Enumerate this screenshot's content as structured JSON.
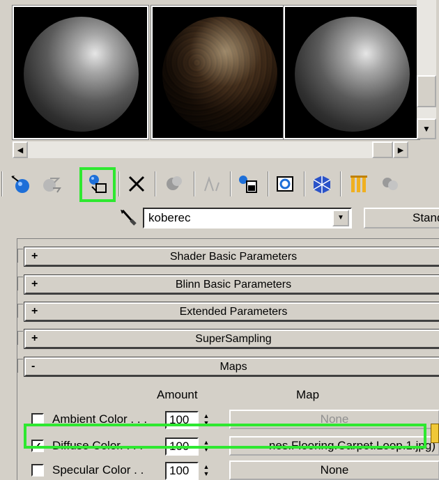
{
  "slots": [
    {
      "material": "gray-sphere"
    },
    {
      "material": "carpet-sphere",
      "selected": true
    },
    {
      "material": "gray-sphere"
    }
  ],
  "toolbar": {
    "icons": [
      "get-material-icon",
      "put-to-scene-icon",
      "assign-to-selection-icon",
      "reset-map-icon",
      "make-copy-icon",
      "make-unique-icon",
      "put-to-library-icon",
      "material-effects-channel-icon",
      "show-map-in-viewport-icon",
      "show-end-result-icon",
      "go-to-parent-icon"
    ],
    "highlighted": "assign-to-selection-icon"
  },
  "material": {
    "name": "koberec",
    "type": "Standard"
  },
  "rollouts": [
    {
      "sign": "+",
      "title": "Shader Basic Parameters"
    },
    {
      "sign": "+",
      "title": "Blinn Basic Parameters"
    },
    {
      "sign": "+",
      "title": "Extended Parameters"
    },
    {
      "sign": "+",
      "title": "SuperSampling"
    },
    {
      "sign": "-",
      "title": "Maps"
    }
  ],
  "maps": {
    "header_amount": "Amount",
    "header_map": "Map",
    "rows": [
      {
        "label": "Ambient Color . . .",
        "checked": false,
        "amount": "100",
        "map": "None",
        "disabled": true
      },
      {
        "label": "Diffuse Color. . . .",
        "checked": true,
        "amount": "100",
        "map": "nes.Flooring.Carpet.Loop.1.jpg)",
        "disabled": false
      },
      {
        "label": "Specular Color . .",
        "checked": false,
        "amount": "100",
        "map": "None",
        "disabled": false
      }
    ]
  },
  "accent": {
    "highlight": "#2ee830"
  }
}
